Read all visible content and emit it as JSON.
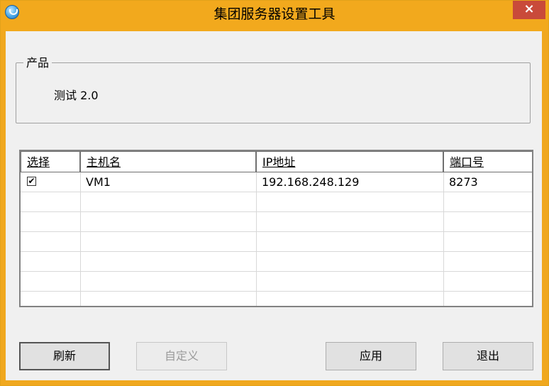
{
  "window": {
    "title": "集团服务器设置工具",
    "close_glyph": "×"
  },
  "product_group": {
    "label": "产品",
    "value": "测试 2.0"
  },
  "server_list": {
    "columns": [
      "选择",
      "主机名",
      "IP地址",
      "端口号"
    ],
    "rows": [
      {
        "selected": true,
        "check_glyph": "✔",
        "hostname": "VM1",
        "ip": "192.168.248.129",
        "port": "8273"
      }
    ]
  },
  "buttons": {
    "refresh": "刷新",
    "custom": "自定义",
    "apply": "应用",
    "exit": "退出"
  }
}
